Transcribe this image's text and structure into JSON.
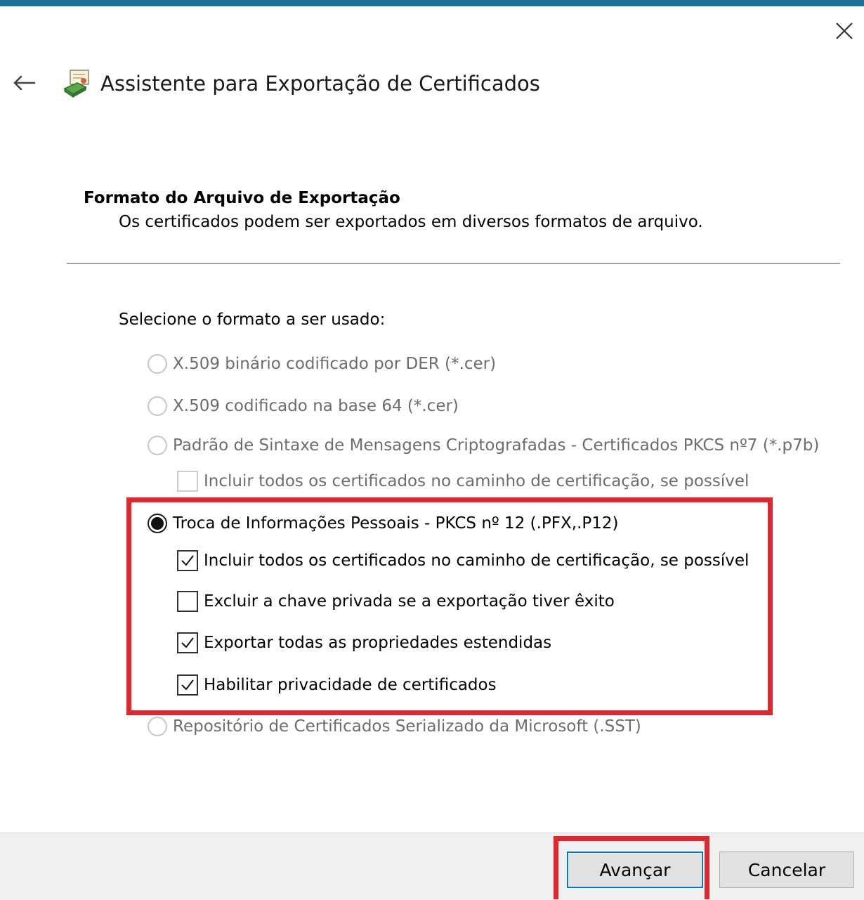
{
  "window": {
    "title": "Assistente para Exportação de Certificados",
    "accent_color": "#1f6f98",
    "close_icon": "close-icon",
    "back_icon": "back-arrow-icon",
    "wizard_icon": "certificate-wizard-icon"
  },
  "section": {
    "title": "Formato do Arquivo de Exportação",
    "description": "Os certificados podem ser exportados em diversos formatos de arquivo."
  },
  "prompt": "Selecione o formato a ser usado:",
  "formats": [
    {
      "label": "X.509 binário codificado por DER (*.cer)",
      "selected": false,
      "enabled": false
    },
    {
      "label": "X.509 codificado na base 64 (*.cer)",
      "selected": false,
      "enabled": false
    },
    {
      "label": "Padrão de Sintaxe de Mensagens Criptografadas - Certificados PKCS nº7 (*.p7b)",
      "selected": false,
      "enabled": false
    },
    {
      "label": "Troca de Informações Pessoais - PKCS nº 12 (.PFX,.P12)",
      "selected": true,
      "enabled": true
    },
    {
      "label": "Repositório de Certificados Serializado da Microsoft (.SST)",
      "selected": false,
      "enabled": false
    }
  ],
  "p7b_options": [
    {
      "label": "Incluir todos os certificados no caminho de certificação, se possível",
      "checked": false,
      "enabled": false
    }
  ],
  "pfx_options": [
    {
      "label": "Incluir todos os certificados no caminho de certificação, se possível",
      "checked": true,
      "enabled": true
    },
    {
      "label": "Excluir a chave privada se a exportação tiver êxito",
      "checked": false,
      "enabled": true
    },
    {
      "label": "Exportar todas as propriedades estendidas",
      "checked": true,
      "enabled": true
    },
    {
      "label": "Habilitar privacidade de certificados",
      "checked": true,
      "enabled": true
    }
  ],
  "buttons": {
    "next": "Avançar",
    "cancel": "Cancelar"
  },
  "annotation_color": "#e0262e"
}
